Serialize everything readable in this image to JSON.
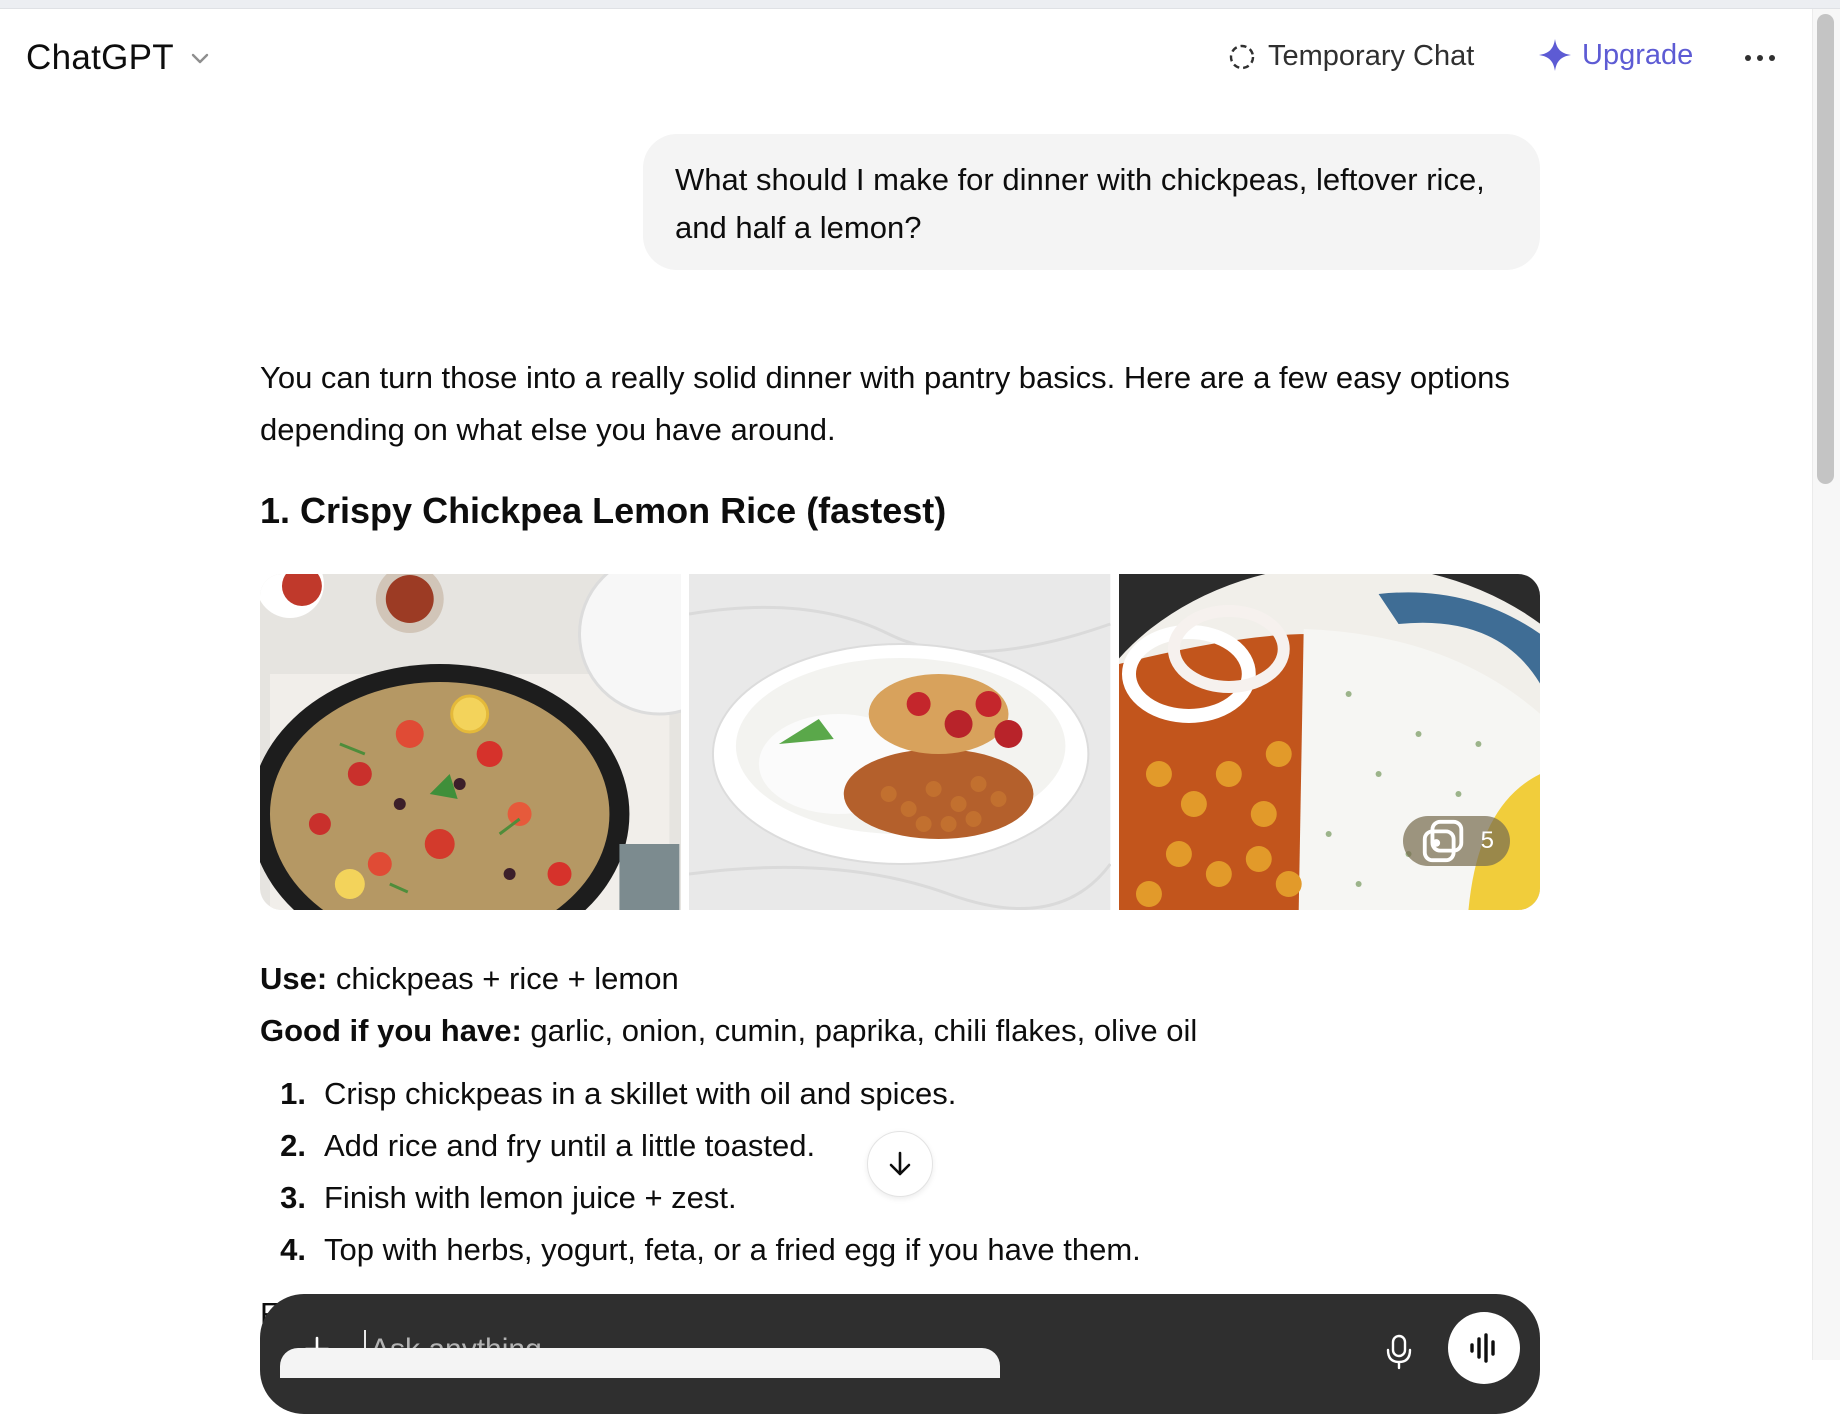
{
  "header": {
    "app_title": "ChatGPT",
    "temporary_chat_label": "Temporary Chat",
    "upgrade_label": "Upgrade",
    "accent_color": "#5d5bd4"
  },
  "user_message": {
    "text": "What should I make for dinner with chickpeas, leftover rice, and half a lemon?"
  },
  "assistant": {
    "intro": "You can turn those into a really solid dinner with pantry basics. Here are a few easy options depending on what else you have around.",
    "section_title": "1. Crispy Chickpea Lemon Rice (fastest)",
    "images": [
      {
        "name": "skillet-rice-image"
      },
      {
        "name": "chickpea-bowl-image"
      },
      {
        "name": "chickpea-curry-image"
      }
    ],
    "image_count": "5",
    "use_label": "Use:",
    "use_text": "chickpeas + rice + lemon",
    "good_label": "Good if you have:",
    "good_text": "garlic, onion, cumin, paprika, chili flakes, olive oil",
    "steps": [
      {
        "num": "1.",
        "text": "Crisp chickpeas in a skillet with oil and spices."
      },
      {
        "num": "2.",
        "text": "Add rice and fry until a little toasted."
      },
      {
        "num": "3.",
        "text": "Finish with lemon juice + zest."
      },
      {
        "num": "4.",
        "text": "Top with herbs, yogurt, feta, or a fried egg if you have them."
      }
    ],
    "peek_text": "Fl"
  },
  "composer": {
    "placeholder": "Ask anything"
  }
}
